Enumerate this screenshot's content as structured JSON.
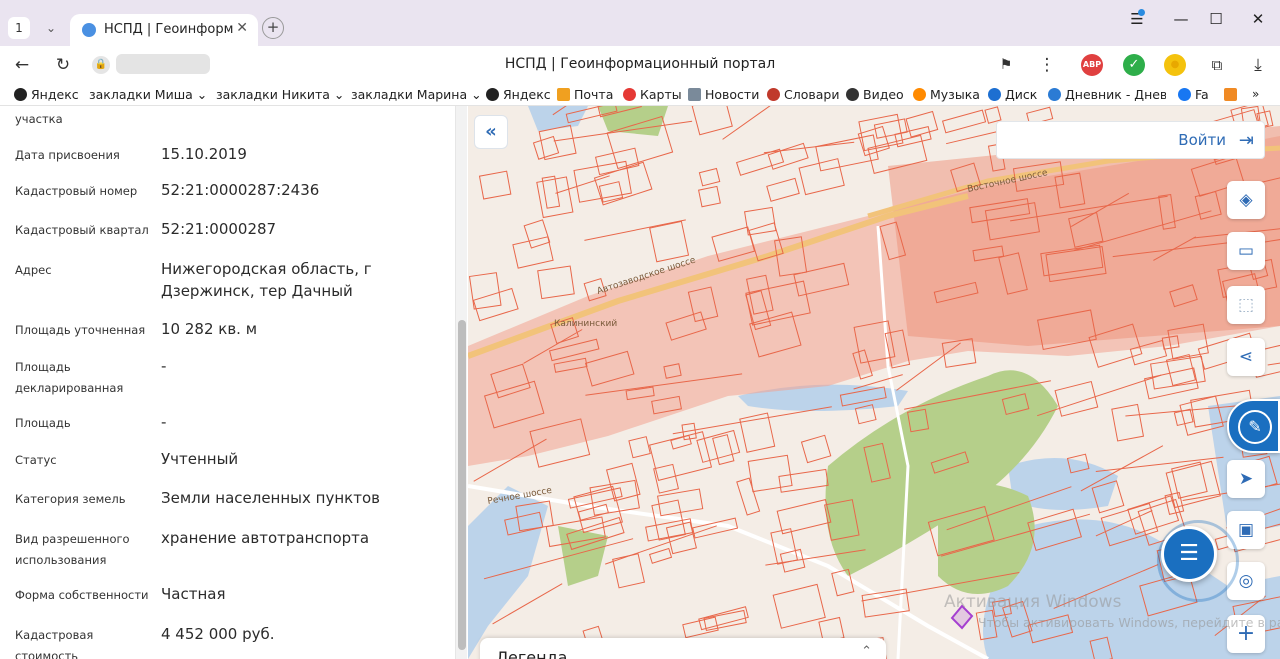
{
  "browser": {
    "tab_count": "1",
    "tab_title": "НСПД | Геоинформационный портал",
    "address_title": "НСПД | Геоинформационный портал",
    "extensions": [
      {
        "name": "adblock",
        "label": "ABP",
        "color": "#e04040"
      },
      {
        "name": "checked",
        "label": "✓",
        "color": "#2eae4a"
      },
      {
        "name": "coin",
        "label": "●",
        "color": "#f4c20d"
      }
    ]
  },
  "bookmarks": [
    {
      "label": "Яндекс",
      "icon": "yandex-icon",
      "color": "#222"
    },
    {
      "label": "закладки Миша ⌄",
      "icon": "",
      "color": ""
    },
    {
      "label": "закладки Никита ⌄",
      "icon": "",
      "color": ""
    },
    {
      "label": "закладки Марина ⌄",
      "icon": "",
      "color": ""
    },
    {
      "label": "Яндекс",
      "icon": "yandex-icon",
      "color": "#222"
    },
    {
      "label": "Почта",
      "icon": "mail-icon",
      "color": "#f0a020"
    },
    {
      "label": "Карты",
      "icon": "maps-icon",
      "color": "#e53935"
    },
    {
      "label": "Новости",
      "icon": "news-icon",
      "color": "#7a8a9a"
    },
    {
      "label": "Словари",
      "icon": "dictionary-icon",
      "color": "#c0392b"
    },
    {
      "label": "Видео",
      "icon": "video-icon",
      "color": "#333"
    },
    {
      "label": "Музыка",
      "icon": "music-icon",
      "color": "#ff8a00"
    },
    {
      "label": "Диск",
      "icon": "disk-icon",
      "color": "#1d6fd1"
    },
    {
      "label": "Дневник - Дневн",
      "icon": "diary-icon",
      "color": "#2b7bd4"
    },
    {
      "label": "Fa",
      "icon": "facebook-icon",
      "color": "#1877f2"
    }
  ],
  "parcel": {
    "fields": [
      {
        "label": "участка",
        "value": ""
      },
      {
        "label": "Дата присвоения",
        "value": "15.10.2019"
      },
      {
        "label": "Кадастровый номер",
        "value": "52:21:0000287:2436"
      },
      {
        "label": "Кадастровый квартал",
        "value": "52:21:0000287"
      },
      {
        "label": "Адрес",
        "value": "Нижегородская область, г Дзержинск, тер Дачный"
      },
      {
        "label": "Площадь уточненная",
        "value": "10 282 кв. м"
      },
      {
        "label": "Площадь декларированная",
        "value": "-"
      },
      {
        "label": "Площадь",
        "value": "-"
      },
      {
        "label": "Статус",
        "value": "Учтенный"
      },
      {
        "label": "Категория земель",
        "value": "Земли населенных пунктов"
      },
      {
        "label": "Вид разрешенного использования",
        "value": "хранение автотранспорта"
      },
      {
        "label": "Форма собственности",
        "value": "Частная"
      },
      {
        "label": "Кадастровая стоимость",
        "value": "4 452 000 руб."
      }
    ]
  },
  "map": {
    "login_label": "Войти",
    "legend_title": "Легенда",
    "road_labels": [
      "Автозаводское шоссе",
      "Восточное шоссе",
      "Калининский",
      "Речное шоссе"
    ],
    "watermark_title": "Активация Windows",
    "watermark_sub": "Чтобы активировать Windows, перейдите в раздел \"Параметры\".",
    "tools": [
      "layers-icon",
      "ruler-icon",
      "select-area-icon",
      "share-icon",
      "assistant-icon",
      "geolocation-icon",
      "minimap-icon",
      "search-location-icon",
      "zoom-in-icon"
    ],
    "colors": {
      "parcel_line": "#e8674a",
      "parcel_fill": "#f3a38f",
      "water": "#bcd3ea",
      "forest": "#b5cf8a",
      "accent": "#1a6fc0"
    }
  }
}
